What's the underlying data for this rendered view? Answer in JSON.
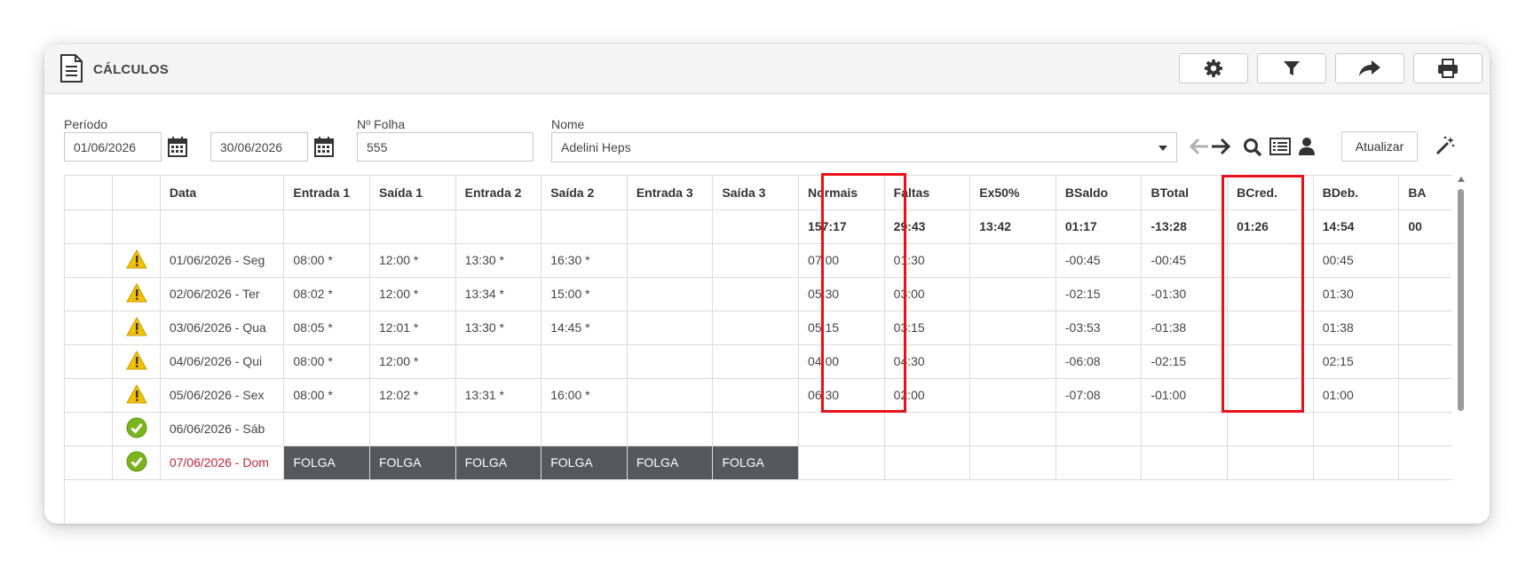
{
  "header": {
    "title": "CÁLCULOS",
    "buttons": [
      {
        "icon": "gear-icon"
      },
      {
        "icon": "filter-icon"
      },
      {
        "icon": "share-icon"
      },
      {
        "icon": "print-icon"
      }
    ]
  },
  "filters": {
    "periodo_label": "Período",
    "date_start": "01/06/2026",
    "date_end": "30/06/2026",
    "folha_label": "Nº Folha",
    "folha_value": "555",
    "nome_label": "Nome",
    "nome_value": "Adelini Heps",
    "atualizar_label": "Atualizar"
  },
  "table": {
    "columns": [
      "",
      "",
      "Data",
      "Entrada 1",
      "Saída 1",
      "Entrada 2",
      "Saída 2",
      "Entrada 3",
      "Saída 3",
      "Normais",
      "Faltas",
      "Ex50%",
      "BSaldo",
      "BTotal",
      "BCred.",
      "BDeb.",
      "BA"
    ],
    "totals": [
      "",
      "",
      "",
      "",
      "",
      "",
      "",
      "",
      "",
      "157:17",
      "29:43",
      "13:42",
      "01:17",
      "-13:28",
      "01:26",
      "14:54",
      "00"
    ],
    "rows": [
      {
        "status": "warning",
        "cells": [
          "01/06/2026 - Seg",
          "08:00 *",
          "12:00 *",
          "13:30 *",
          "16:30 *",
          "",
          "",
          "07:00",
          "01:30",
          "",
          "-00:45",
          "-00:45",
          "",
          "00:45",
          ""
        ]
      },
      {
        "status": "warning",
        "cells": [
          "02/06/2026 - Ter",
          "08:02 *",
          "12:00 *",
          "13:34 *",
          "15:00 *",
          "",
          "",
          "05:30",
          "03:00",
          "",
          "-02:15",
          "-01:30",
          "",
          "01:30",
          ""
        ]
      },
      {
        "status": "warning",
        "cells": [
          "03/06/2026 - Qua",
          "08:05 *",
          "12:01 *",
          "13:30 *",
          "14:45 *",
          "",
          "",
          "05:15",
          "03:15",
          "",
          "-03:53",
          "-01:38",
          "",
          "01:38",
          ""
        ]
      },
      {
        "status": "warning",
        "cells": [
          "04/06/2026 - Qui",
          "08:00 *",
          "12:00 *",
          "",
          "",
          "",
          "",
          "04:00",
          "04:30",
          "",
          "-06:08",
          "-02:15",
          "",
          "02:15",
          ""
        ]
      },
      {
        "status": "warning",
        "cells": [
          "05/06/2026 - Sex",
          "08:00 *",
          "12:02 *",
          "13:31 *",
          "16:00 *",
          "",
          "",
          "06:30",
          "02:00",
          "",
          "-07:08",
          "-01:00",
          "",
          "01:00",
          ""
        ]
      },
      {
        "status": "ok",
        "cells": [
          "06/06/2026 - Sáb",
          "",
          "",
          "",
          "",
          "",
          "",
          "",
          "",
          "",
          "",
          "",
          "",
          "",
          ""
        ]
      },
      {
        "status": "ok",
        "sunday": true,
        "cells": [
          "07/06/2026 - Dom",
          "FOLGA",
          "FOLGA",
          "FOLGA",
          "FOLGA",
          "FOLGA",
          "FOLGA",
          "",
          "",
          "",
          "",
          "",
          "",
          "",
          ""
        ]
      }
    ]
  },
  "colors": {
    "highlight": "#e8101a",
    "warning": "#f2c200",
    "ok": "#7ab51d",
    "folga_bg": "#56585c",
    "sunday_text": "#c2273a"
  }
}
